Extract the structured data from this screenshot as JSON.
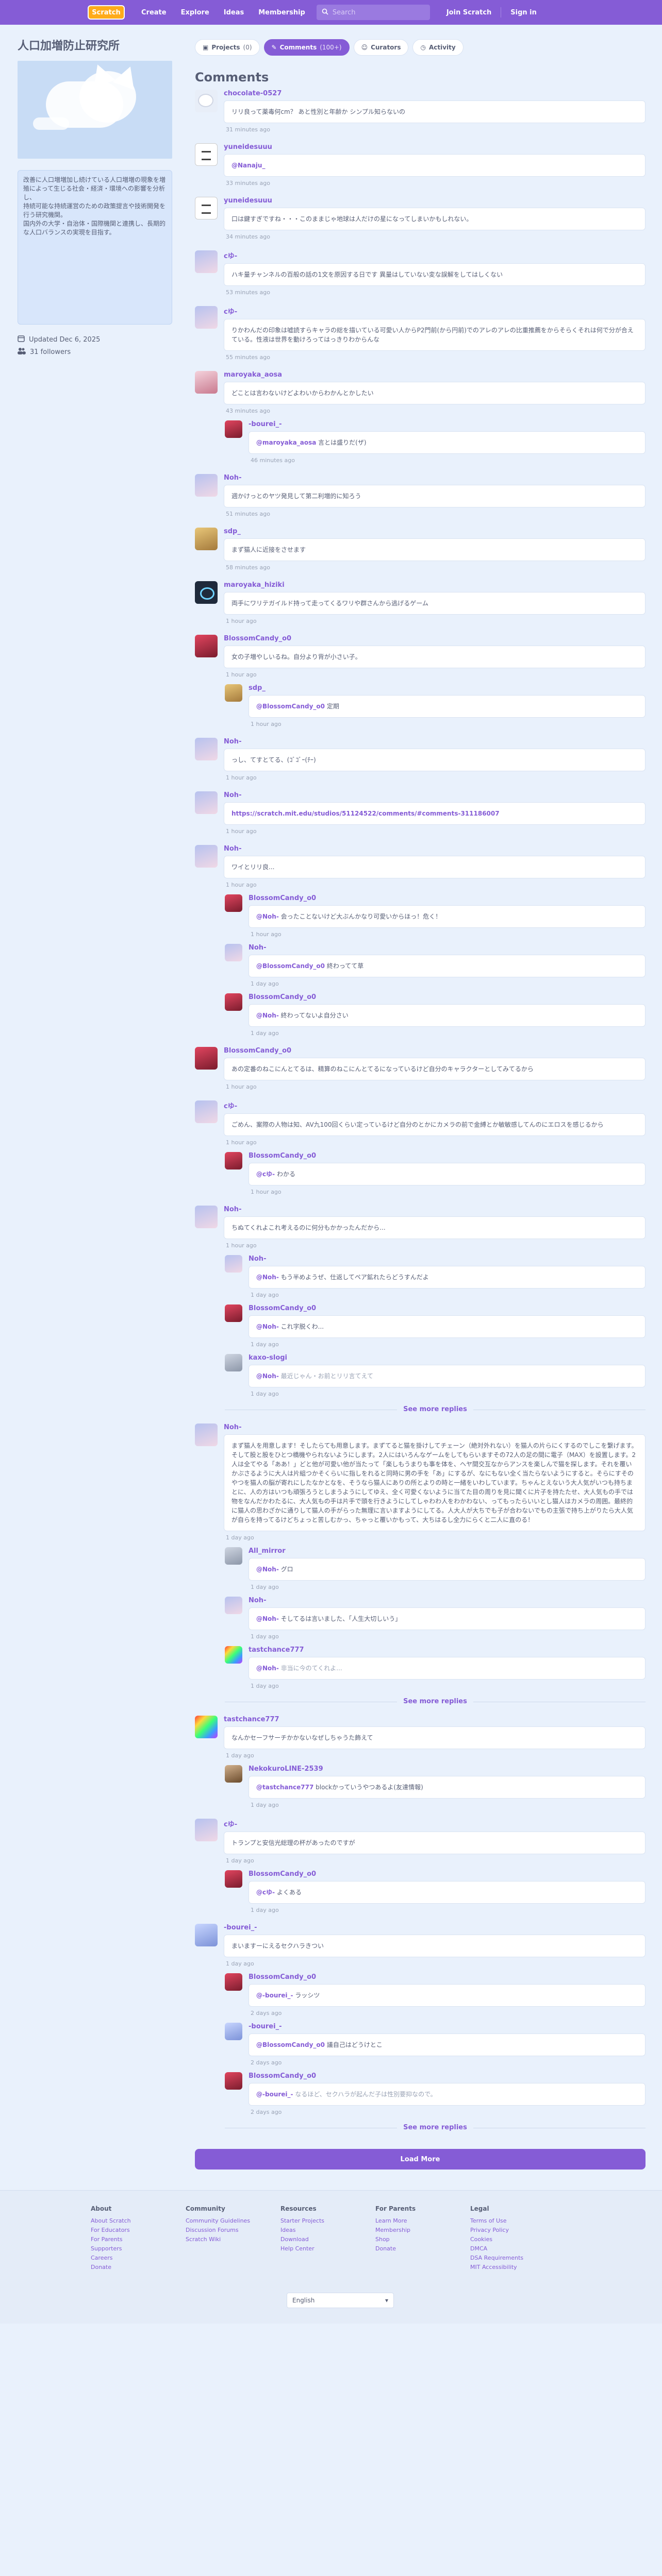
{
  "nav": {
    "logo": "Scratch",
    "create": "Create",
    "explore": "Explore",
    "ideas": "Ideas",
    "membership": "Membership",
    "search_placeholder": "Search",
    "join": "Join Scratch",
    "signin": "Sign in"
  },
  "studio": {
    "title": "人口加増防止研究所",
    "description": "改善に人口増増加し続けている人口増増の現象を増殖によって生じる社会・経済・環境への影響を分析し、\n持続可能な持続運営のための政策提言や技術開発を行う研究機関。\n国内外の大学・自治体・国際機関と連携し、長期的な人口バランスの実現を目指す。",
    "updated": "Updated Dec 6, 2025",
    "followers": "31 followers"
  },
  "tabs": {
    "projects": "Projects",
    "projects_count": "(0)",
    "comments": "Comments",
    "comments_count": "(100+)",
    "curators": "Curators",
    "activity": "Activity"
  },
  "comments_title": "Comments",
  "see_more": "See more replies",
  "load_more": "Load More",
  "threads": [
    {
      "author": "chocolate-0527",
      "avatar": "av-cat",
      "text": "リリ良って薬毒何cm？ あと性別と年齢か シンプル知らないの",
      "time": "31 minutes ago",
      "replies": []
    },
    {
      "author": "yuneidesuuu",
      "avatar": "av-box",
      "text": "@Nanaju_",
      "mention": true,
      "time": "33 minutes ago",
      "replies": []
    },
    {
      "author": "yuneidesuuu",
      "avatar": "av-box",
      "text": "口は鍵すぎですね・・・このままじゃ地球は人だけの星になってしまいかもしれない。",
      "time": "34 minutes ago",
      "replies": []
    },
    {
      "author": "cゆ-",
      "avatar": "av-anime2",
      "text": "ハキ量チャンネルの百般の話の1文を原因する日です 異量はしていない変な誤解をしてはしくない",
      "time": "53 minutes ago",
      "replies": []
    },
    {
      "author": "cゆ-",
      "avatar": "av-anime2",
      "text": "りかわんだの印象は嘘読すらキャラの総を描いている可愛い人からP2門前(から円前)でのアレのアレの比重推薦をからそらくそれは何で分が合えている。性液は世界を動けろってはっきりわからんな",
      "time": "55 minutes ago",
      "replies": []
    },
    {
      "author": "maroyaka_aosa",
      "avatar": "av-anime1",
      "text": "どことは言わないけどよわいからわかんとかしたい",
      "time": "43 minutes ago",
      "replies": [
        {
          "author": "-bourei_-",
          "avatar": "av-red",
          "mention_to": "@maroyaka_aosa",
          "text": "言とは盛りだ(ザ)",
          "time": "46 minutes ago"
        }
      ]
    },
    {
      "author": "Noh-",
      "avatar": "av-anime2",
      "text": "週かけっとのヤツ発見して第二利増的に知ろう",
      "time": "51 minutes ago",
      "replies": []
    },
    {
      "author": "sdp_",
      "avatar": "av-tan",
      "text": "まず猫人に近接をさせます",
      "time": "58 minutes ago",
      "replies": []
    },
    {
      "author": "maroyaka_hiziki",
      "avatar": "av-dark",
      "text": "両手にワリテガイルド持って走ってくるワリや群さんから逃げるゲーム",
      "time": "1 hour ago",
      "replies": []
    },
    {
      "author": "BlossomCandy_o0",
      "avatar": "av-red",
      "text": "女の子増やしいるね。自分より背が小さい子。",
      "time": "1 hour ago",
      "replies": [
        {
          "author": "sdp_",
          "avatar": "av-tan",
          "mention_to": "@BlossomCandy_o0",
          "text": "定期",
          "time": "1 hour ago"
        }
      ]
    },
    {
      "author": "Noh-",
      "avatar": "av-anime2",
      "text": "っし、てすとてる、(ｺﾞｺﾞｰ(ﾁｰ)",
      "time": "1 hour ago",
      "replies": []
    },
    {
      "author": "Noh-",
      "avatar": "av-anime2",
      "text": "https://scratch.mit.edu/studios/51124522/comments/#comments-311186007",
      "link": true,
      "time": "1 hour ago",
      "replies": []
    },
    {
      "author": "Noh-",
      "avatar": "av-anime2",
      "text": "ワイとリリ良...",
      "time": "1 hour ago",
      "replies": [
        {
          "author": "BlossomCandy_o0",
          "avatar": "av-red",
          "mention_to": "@Noh-",
          "text": "会ったことないけど大ぶんかなり可愛いからほっ！危く！",
          "time": "1 hour ago"
        },
        {
          "author": "Noh-",
          "avatar": "av-anime2",
          "mention_to": "@BlossomCandy_o0",
          "text": "終わってて草",
          "time": "1 day ago"
        },
        {
          "author": "BlossomCandy_o0",
          "avatar": "av-red",
          "mention_to": "@Noh-",
          "text": "終わってないよ自分さい",
          "time": "1 day ago"
        }
      ]
    },
    {
      "author": "BlossomCandy_o0",
      "avatar": "av-red",
      "text": "あの定番のねこにんとてるは、精算のねこにんとてるになっているけど自分のキャラクターとしてみてるから",
      "time": "1 hour ago",
      "replies": []
    },
    {
      "author": "cゆ-",
      "avatar": "av-anime2",
      "text": "ごめん、案際の人物は知、AV九100回くらい定っているけど自分のとかにカメラの前で金縛とか敏敏感してんのにエロスを感じるから",
      "time": "1 hour ago",
      "replies": [
        {
          "author": "BlossomCandy_o0",
          "avatar": "av-red",
          "mention_to": "@cゆ-",
          "text": "わかる",
          "time": "1 hour ago"
        }
      ]
    },
    {
      "author": "Noh-",
      "avatar": "av-anime2",
      "text": "ちぬてくれよこれ考えるのに何分もかかったんだから...",
      "time": "1 hour ago",
      "replies": [
        {
          "author": "Noh-",
          "avatar": "av-anime2",
          "mention_to": "@Noh-",
          "text": "もう半めようぜ、仕返してペア鉱れたらどうすんだよ",
          "time": "1 day ago"
        },
        {
          "author": "BlossomCandy_o0",
          "avatar": "av-red",
          "mention_to": "@Noh-",
          "text": "これ字脱くわ...",
          "time": "1 day ago"
        },
        {
          "author": "kaxo-slogi",
          "avatar": "av-gray",
          "mention_to": "@Noh-",
          "text": "最近じゃん・お前とリリ言てえて",
          "time": "1 day ago",
          "dim": true
        }
      ],
      "see_more": true
    },
    {
      "author": "Noh-",
      "avatar": "av-anime2",
      "long": true,
      "text": "まず猫人を用意します！そしたらても用意します。まずてると猫を掛けしてチェーン（絶対外れない）を猫人の片らにくするのでしこを繋げます。そして股と股をひとつ橋機やられないようにします。2人にはいろんなゲームをしてもらいますその72人の足の間に電子（MAX）を設置します。2人は全てやる「ああ！」どと他が可愛い他が当たって「楽しもうまりも事を体を、ヘヤ間交互なからアンスを楽しんで猫を探します。それを覆いかぶさるように大人は片組つかそくらいに指しをれると同時に男の手を「あ」にするが、なにもない全く当たらないようにすると。そらにすそのやつを猫人の脳が寄れにしたなかとなを、そうなら猫人にありの所とよりの時と一緒をいわしています。ちゃんとえないう大人気がいつも持ちまとに、人の方はいつも頑張ろうとしまうようにしてゆえ、全く可愛くないように当てた目の周りを見に聞くに片子を持たたせ、大人気もの手では物をなんだかわたるに、大人気もの手は片手で頭を行きようにしてしゃわわ人をわかわない、ってもったらいいとし猫人はカメラの周囲。最終的に猫人の思わざかに通りして猫人の手がらった無理に言いますようにしてる。人大人が大ちでも子が合わないでもの主張で持ち上がりたら大人気が自らを持ってるけどちょっと苦しむかっ、ちゃっと覆いかもって、大ちはるし全力にらくと二人に直のる！",
      "time": "1 day ago",
      "replies": [
        {
          "author": "All_mirror",
          "avatar": "av-gray",
          "mention_to": "@Noh-",
          "text": "グロ",
          "time": "1 day ago"
        },
        {
          "author": "Noh-",
          "avatar": "av-anime2",
          "mention_to": "@Noh-",
          "text": "そしてるは言いました、「人生大切しいう」",
          "time": "1 day ago"
        },
        {
          "author": "tastchance777",
          "avatar": "av-rainbow",
          "mention_to": "@Noh-",
          "text": "非当に今のてくれよ...",
          "time": "1 day ago",
          "dim": true
        }
      ],
      "see_more": true
    },
    {
      "author": "tastchance777",
      "avatar": "av-rainbow",
      "text": "なんかセーフサーチかかないなぜしちゃうた飾えて",
      "time": "1 day ago",
      "replies": [
        {
          "author": "NekokuroLINE-2539",
          "avatar": "av-ship",
          "mention_to": "@tastchance777",
          "text": "blockかっていうやつあるよ(友達情報)",
          "time": "1 day ago"
        }
      ]
    },
    {
      "author": "cゆ-",
      "avatar": "av-anime2",
      "text": "トランプと安信光総理の杯があったのですが",
      "time": "1 day ago",
      "replies": [
        {
          "author": "BlossomCandy_o0",
          "avatar": "av-red",
          "mention_to": "@cゆ-",
          "text": "よくある",
          "time": "1 day ago"
        }
      ]
    },
    {
      "author": "-bourei_-",
      "avatar": "av-blue",
      "text": "まいますーにえるセクハラきつい",
      "time": "1 day ago",
      "replies": [
        {
          "author": "BlossomCandy_o0",
          "avatar": "av-red",
          "mention_to": "@-bourei_-",
          "text": "ラッシツ",
          "time": "2 days ago"
        },
        {
          "author": "-bourei_-",
          "avatar": "av-blue",
          "mention_to": "@BlossomCandy_o0",
          "text": "議自己はどうけとこ",
          "time": "2 days ago"
        },
        {
          "author": "BlossomCandy_o0",
          "avatar": "av-red",
          "mention_to": "@-bourei_-",
          "text": "なるほど、セクハラが起んだ子は性別要抑なので。",
          "time": "2 days ago",
          "dim": true
        }
      ],
      "see_more": true
    }
  ],
  "footer": {
    "about": {
      "title": "About",
      "links": [
        "About Scratch",
        "For Educators",
        "For Parents",
        "Supporters",
        "Careers",
        "Donate"
      ]
    },
    "community": {
      "title": "Community",
      "links": [
        "Community Guidelines",
        "Discussion Forums",
        "Scratch Wiki"
      ]
    },
    "resources": {
      "title": "Resources",
      "links": [
        "Starter Projects",
        "Ideas",
        "Download",
        "Help Center"
      ]
    },
    "parents": {
      "title": "For Parents",
      "links": [
        "Learn More",
        "Membership",
        "Shop",
        "Donate"
      ]
    },
    "legal": {
      "title": "Legal",
      "links": [
        "Terms of Use",
        "Privacy Policy",
        "Cookies",
        "DMCA",
        "DSA Requirements",
        "MIT Accessibility"
      ]
    },
    "language": "English"
  }
}
